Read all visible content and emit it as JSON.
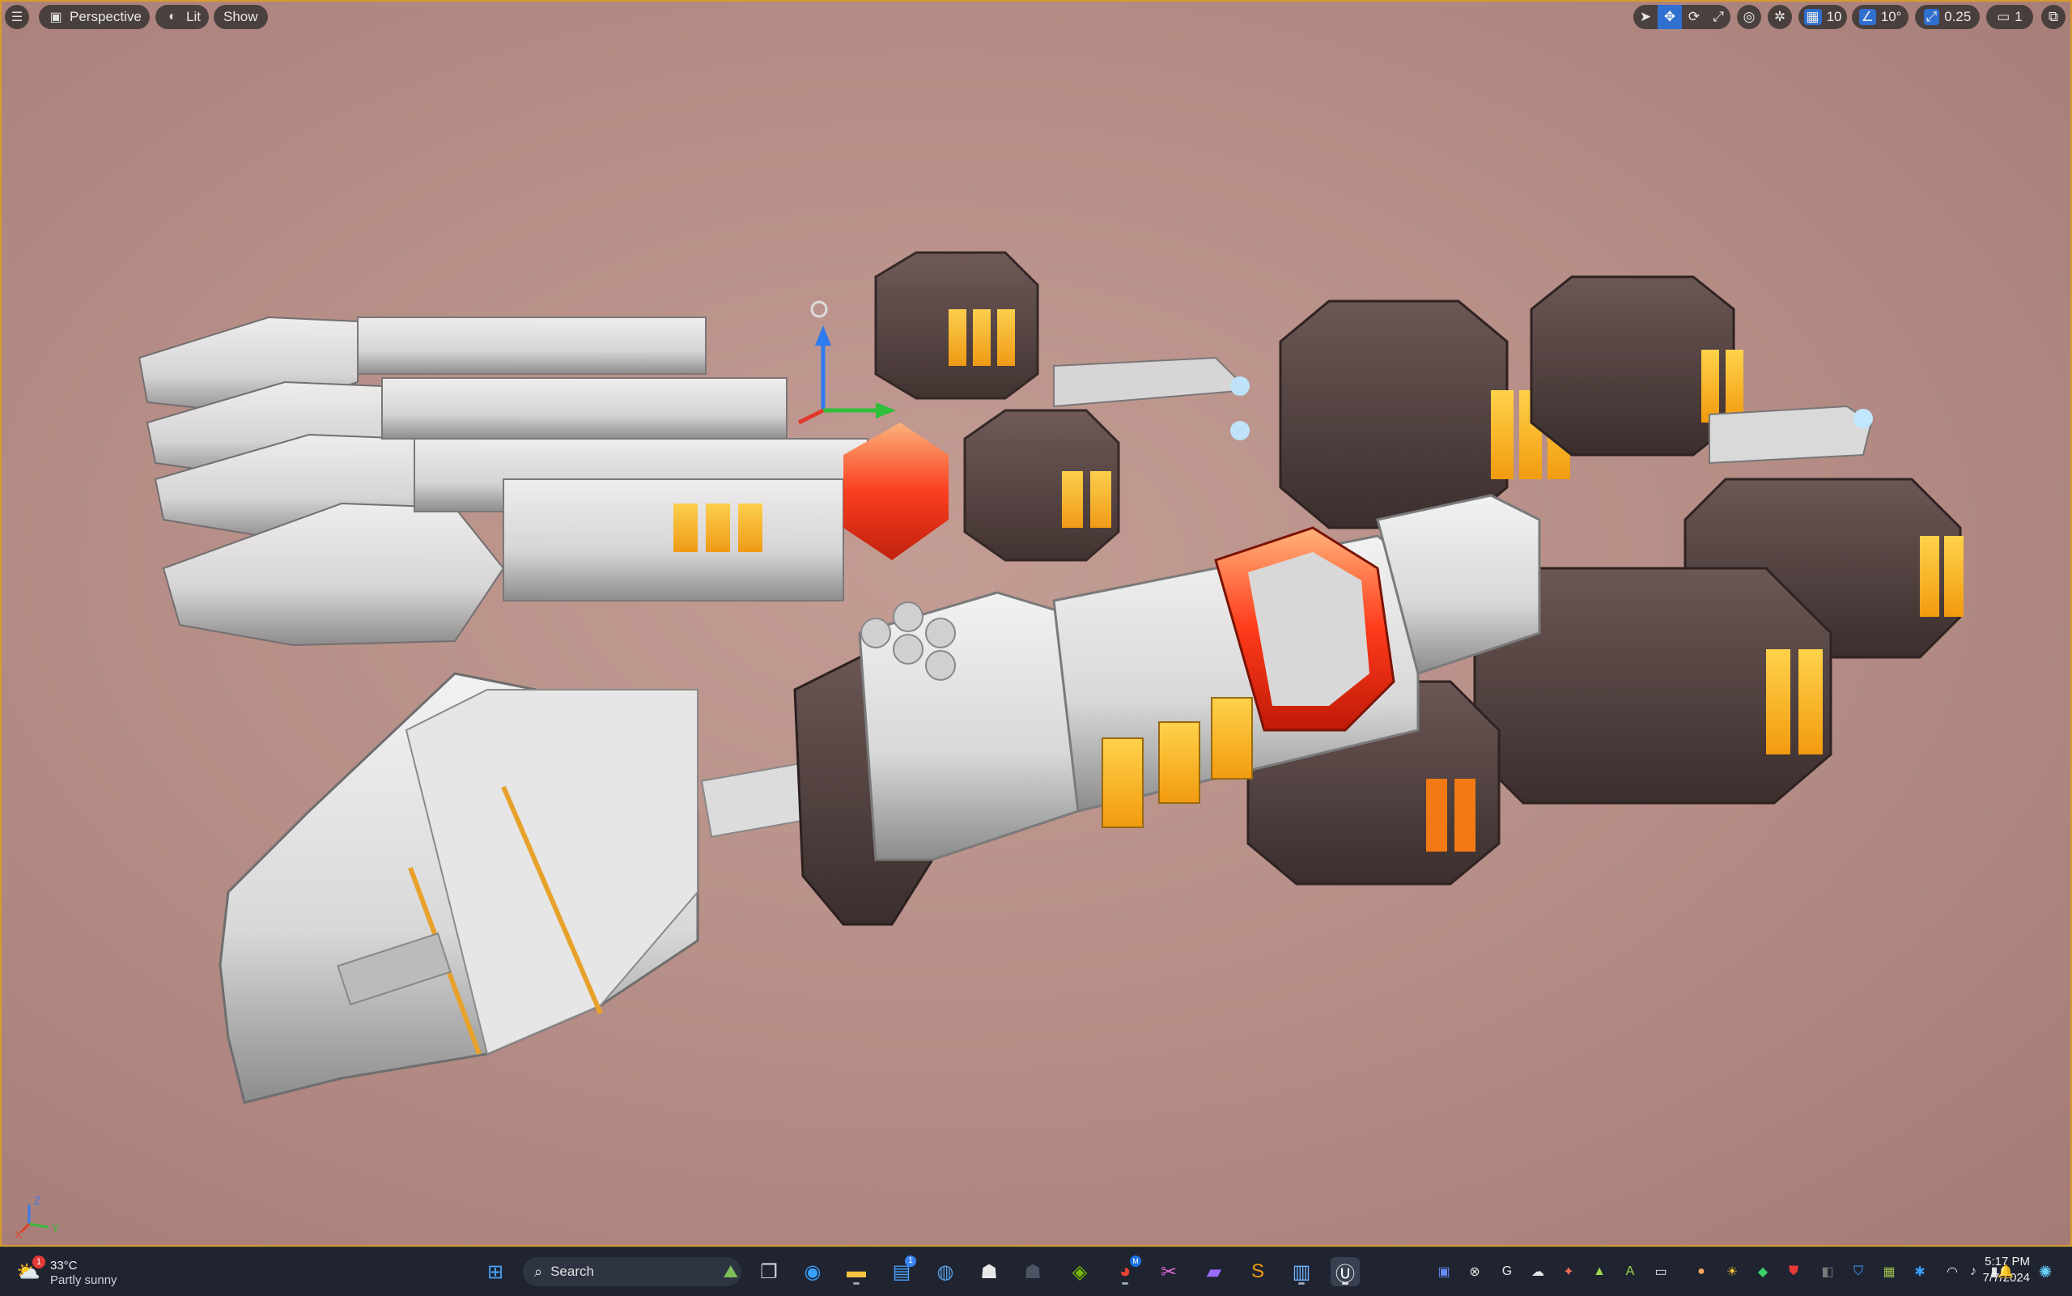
{
  "viewport": {
    "menu_icon": "hamburger-icon",
    "view_mode": "Perspective",
    "lighting_mode": "Lit",
    "show_label": "Show",
    "grid_snap_value": "10",
    "rotation_snap_value": "10°",
    "scale_snap_value": "0.25",
    "camera_speed_value": "1",
    "axis_labels": {
      "x": "X",
      "y": "Y",
      "z": "Z"
    },
    "colors": {
      "background": "#b48c85",
      "frame_accent": "#d79a2b",
      "active_tool": "#2f6fd0"
    }
  },
  "taskbar": {
    "weather": {
      "temperature": "33°C",
      "condition": "Partly sunny",
      "badge": "1"
    },
    "search_placeholder": "Search",
    "store_badge": "1",
    "chrome_badge": "M",
    "clock": {
      "time": "5:17 PM",
      "date": "7/7/2024"
    }
  }
}
